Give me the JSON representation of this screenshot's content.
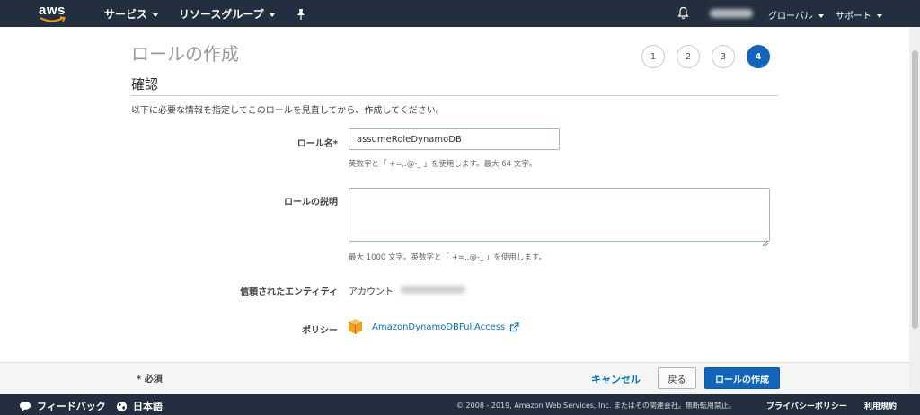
{
  "nav": {
    "logo_text": "aws",
    "services": "サービス",
    "resource_groups": "リソースグループ",
    "region": "グローバル",
    "support": "サポート"
  },
  "page": {
    "title": "ロールの作成",
    "steps": [
      "1",
      "2",
      "3",
      "4"
    ],
    "active_step": "4",
    "section_title": "確認",
    "intro": "以下に必要な情報を指定してこのロールを見直してから、作成してください。"
  },
  "form": {
    "role_name_label": "ロール名*",
    "role_name_value": "assumeRoleDynamoDB",
    "role_name_help": "英数字と「 +=,.@-_ 」を使用します。最大 64 文字。",
    "description_label": "ロールの説明",
    "description_value": "",
    "description_help": "最大 1000 文字。英数字と「 +=,.@-_ 」を使用します。",
    "trusted_entity_label": "信頼されたエンティティ",
    "trusted_entity_value": "アカウント",
    "policies_label": "ポリシー",
    "policy_name": "AmazonDynamoDBFullAccess"
  },
  "actions": {
    "required_note": "* 必須",
    "cancel": "キャンセル",
    "back": "戻る",
    "create": "ロールの作成"
  },
  "footer": {
    "feedback": "フィードバック",
    "language": "日本語",
    "copyright": "© 2008 - 2019, Amazon Web Services, Inc. またはその関連会社。無断転用禁止。",
    "privacy": "プライバシーポリシー",
    "terms": "利用規約"
  },
  "colors": {
    "nav_bg": "#232f3e",
    "primary_button": "#1166bb",
    "link": "#0073bb",
    "aws_orange": "#ff9900"
  }
}
